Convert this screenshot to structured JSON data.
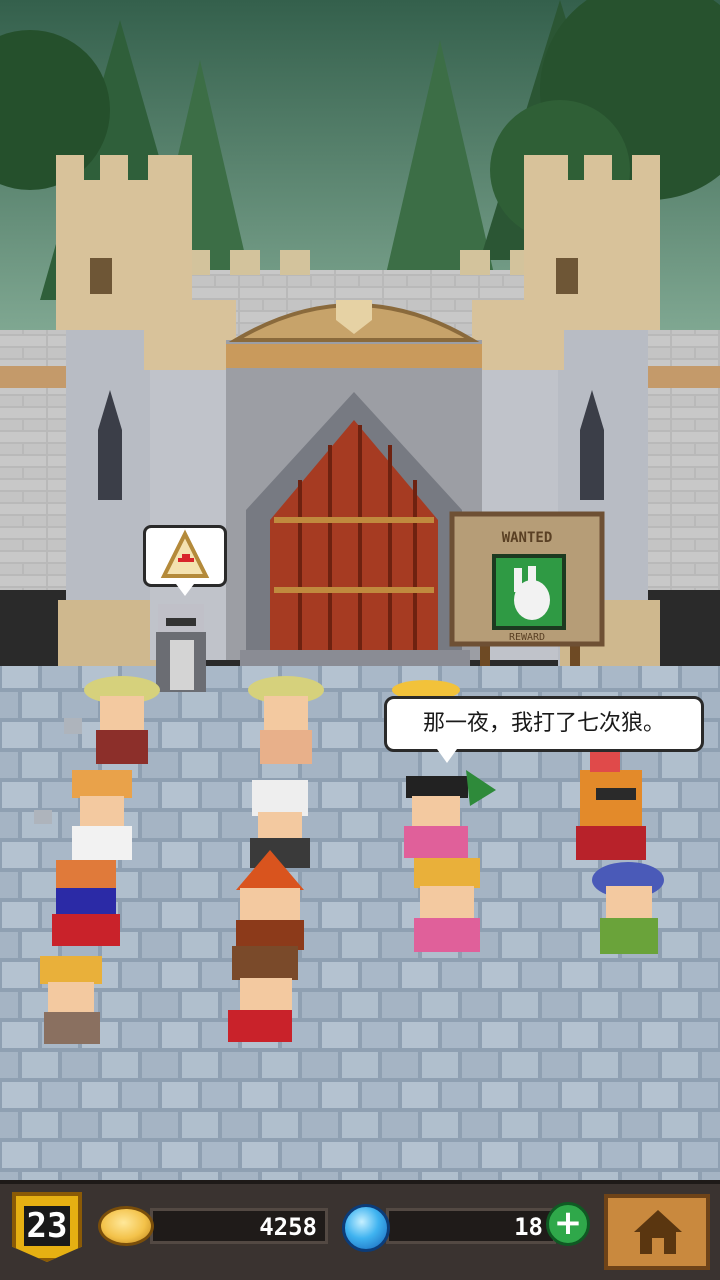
{
  "scene": {
    "speech_text": "那一夜，我打了七次狼。",
    "wanted_sign_title": "WANTED",
    "wanted_sign_footer": "REWARD",
    "wanted_icon": "rabbit-portrait-icon",
    "quest_bubble_icon": "tent-quest-icon"
  },
  "hud": {
    "level": "23",
    "coins": "4258",
    "gems": "18",
    "add_label": "+",
    "home_icon": "home-icon"
  },
  "colors": {
    "sky": "#4f7a61",
    "wall": "#bdbdbd",
    "door": "#a63b22",
    "cobblestone": "#a9b7c6",
    "hud_bg": "#3a3330",
    "badge_gold": "#e6b012"
  }
}
